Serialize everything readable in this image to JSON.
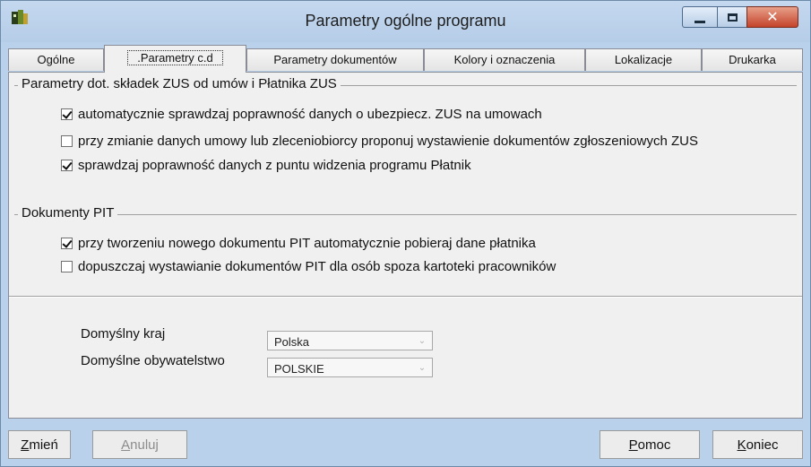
{
  "window": {
    "title": "Parametry ogólne programu"
  },
  "tabs": [
    {
      "label": "Ogólne"
    },
    {
      "label": ".Parametry c.d",
      "active": true
    },
    {
      "label": "Parametry dokumentów"
    },
    {
      "label": "Kolory i oznaczenia"
    },
    {
      "label": "Lokalizacje"
    },
    {
      "label": "Drukarka"
    }
  ],
  "zus_group": {
    "title": "Parametry dot. składek ZUS od umów i Płatnika ZUS",
    "options": [
      {
        "label": "automatycznie sprawdzaj poprawność danych o ubezpiecz. ZUS na umowach",
        "checked": true
      },
      {
        "label": "przy zmianie danych umowy lub zleceniobiorcy  proponuj wystawienie dokumentów zgłoszeniowych ZUS",
        "checked": false
      },
      {
        "label": "sprawdzaj poprawność danych z puntu widzenia programu Płatnik",
        "checked": true
      }
    ]
  },
  "pit_group": {
    "title": "Dokumenty PIT",
    "options": [
      {
        "label": "przy tworzeniu nowego dokumentu PIT automatycznie pobieraj dane płatnika",
        "checked": true
      },
      {
        "label": "dopuszczaj wystawianie dokumentów PIT dla osób spoza kartoteki pracowników",
        "checked": false
      }
    ]
  },
  "defaults": {
    "country_label": "Domyślny kraj",
    "country_value": "Polska",
    "citizenship_label": "Domyślne obywatelstwo",
    "citizenship_value": "POLSKIE"
  },
  "footer": {
    "change_label": "Zmień",
    "change_accel": "Z",
    "change_rest": "mień",
    "cancel_label": "Anuluj",
    "cancel_accel": "A",
    "cancel_rest": "nuluj",
    "help_label": "Pomoc",
    "help_accel": "P",
    "help_rest": "omoc",
    "end_label": "Koniec",
    "end_accel": "K",
    "end_rest": "oniec"
  },
  "colors": {
    "title_bar": "#b9d1ea",
    "close_button": "#c4432b",
    "panel": "#f0f0f0"
  },
  "icons": [
    "app-icon",
    "minimize-icon",
    "maximize-icon",
    "close-icon",
    "chevron-down-icon",
    "checkbox-icon"
  ]
}
